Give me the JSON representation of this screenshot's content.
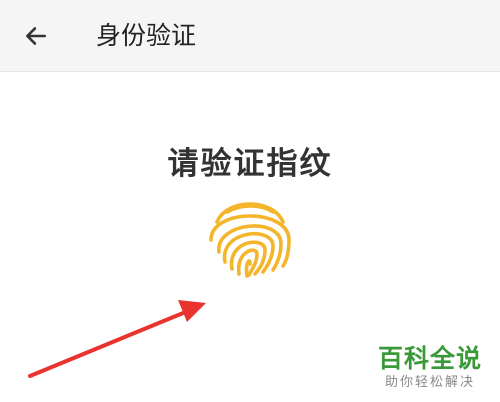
{
  "header": {
    "back_icon": "arrow-left-icon",
    "title": "身份验证"
  },
  "main": {
    "prompt": "请验证指纹",
    "fingerprint_icon": "fingerprint-icon"
  },
  "colors": {
    "fingerprint": "#f5b52a",
    "arrow": "#e8332f",
    "watermark": "#3a9a3a"
  },
  "watermark": {
    "title": "百科全说",
    "subtitle": "助你轻松解决"
  }
}
